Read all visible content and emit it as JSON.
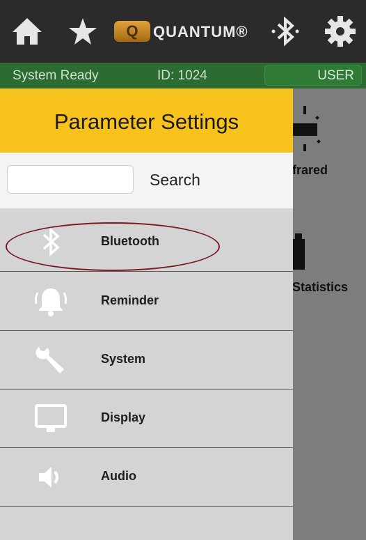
{
  "header": {
    "home_icon": "home-icon",
    "star_icon": "star-icon",
    "logo": {
      "letter": "Q",
      "word": "QUANTUM®"
    },
    "bluetooth_icon": "bluetooth-icon",
    "settings_icon": "gear-icon"
  },
  "status": {
    "text": "System Ready",
    "id": "ID: 1024",
    "user_label": "USER"
  },
  "background": {
    "items": [
      {
        "label": "frared",
        "icon": "infrared-icon"
      },
      {
        "label": "Statistics",
        "icon": "statistics-icon"
      }
    ]
  },
  "drawer": {
    "title": "Parameter Settings",
    "search": {
      "label": "Search",
      "value": "",
      "placeholder": ""
    },
    "items": [
      {
        "label": "Bluetooth",
        "icon": "bluetooth-icon",
        "highlighted": true
      },
      {
        "label": "Reminder",
        "icon": "bell-icon"
      },
      {
        "label": "System",
        "icon": "wrench-icon"
      },
      {
        "label": "Display",
        "icon": "monitor-icon"
      },
      {
        "label": "Audio",
        "icon": "speaker-icon"
      }
    ]
  },
  "colors": {
    "topbar": "#2b2b2b",
    "status": "#2c6b31",
    "drawer_header": "#f7c21b",
    "highlight_ring": "#7a1a24"
  }
}
